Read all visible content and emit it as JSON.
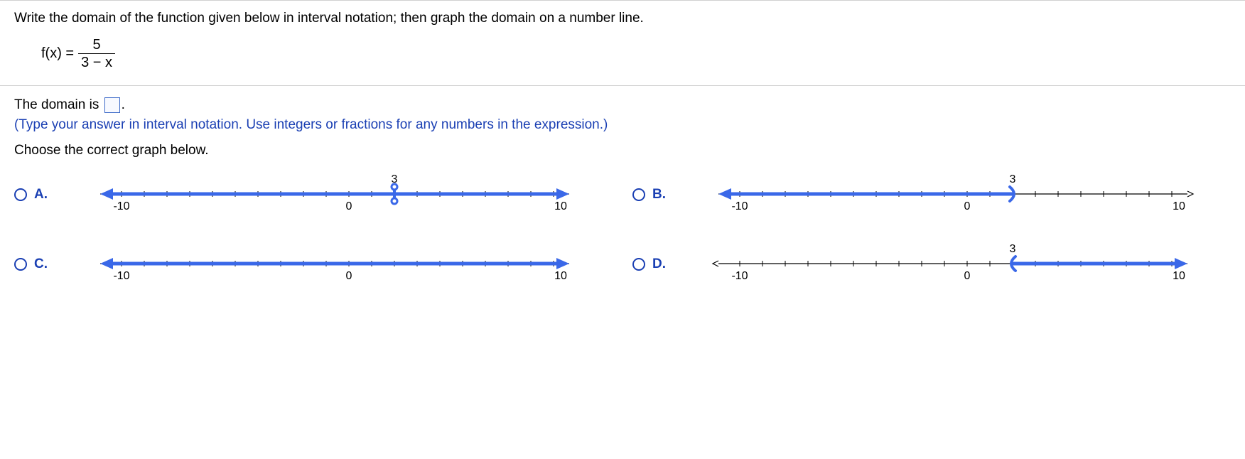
{
  "question": "Write the domain of the function given below in interval notation; then graph the domain on a number line.",
  "fx_lhs": "f(x) =",
  "fraction": {
    "num": "5",
    "den": "3 − x"
  },
  "domain_prefix": "The domain is",
  "domain_suffix": ".",
  "hint": "(Type your answer in interval notation. Use integers or fractions for any numbers in the expression.)",
  "choose": "Choose the correct graph below.",
  "options": {
    "a": {
      "label": "A."
    },
    "b": {
      "label": "B."
    },
    "c": {
      "label": "C."
    },
    "d": {
      "label": "D."
    }
  },
  "chart_data": [
    {
      "option": "A",
      "type": "number-line",
      "range": [
        -10,
        10
      ],
      "ticks": [
        -10,
        0,
        10
      ],
      "marker": {
        "value": 3,
        "type": "open",
        "label": "3"
      },
      "highlight": [
        [
          -10,
          10
        ]
      ],
      "arrows": [
        "left",
        "right"
      ]
    },
    {
      "option": "B",
      "type": "number-line",
      "range": [
        -10,
        10
      ],
      "ticks": [
        -10,
        0,
        10
      ],
      "marker": {
        "value": 3,
        "type": "open-paren-right",
        "label": "3"
      },
      "highlight": [
        [
          -10,
          3
        ]
      ],
      "arrows": [
        "left"
      ]
    },
    {
      "option": "C",
      "type": "number-line",
      "range": [
        -10,
        10
      ],
      "ticks": [
        -10,
        0,
        10
      ],
      "marker": null,
      "highlight": [
        [
          -10,
          10
        ]
      ],
      "arrows": [
        "left",
        "right"
      ]
    },
    {
      "option": "D",
      "type": "number-line",
      "range": [
        -10,
        10
      ],
      "ticks": [
        -10,
        0,
        10
      ],
      "marker": {
        "value": 3,
        "type": "open-paren-left",
        "label": "3"
      },
      "highlight": [
        [
          3,
          10
        ]
      ],
      "arrows": [
        "right"
      ]
    }
  ]
}
